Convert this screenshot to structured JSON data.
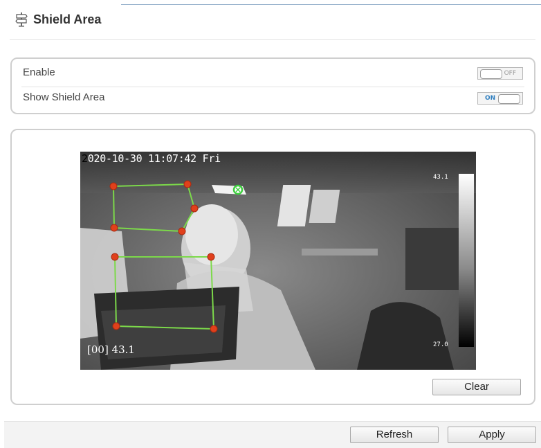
{
  "header": {
    "title": "Shield Area",
    "icon": "signpost-icon"
  },
  "settings": {
    "enable": {
      "label": "Enable",
      "state": "OFF",
      "checked": false
    },
    "show_shield_area": {
      "label": "Show Shield Area",
      "state": "ON",
      "checked": true
    }
  },
  "video": {
    "timestamp_first": "2",
    "timestamp_rest": "020-10-30 11:07:42 Fri",
    "temp_readout": "[00] 43.1",
    "scale_max": "43.1",
    "scale_min": "27.0",
    "shield_line_color": "#7cd94a",
    "vertex_color": "#e0401c"
  },
  "buttons": {
    "clear": "Clear",
    "refresh": "Refresh",
    "apply": "Apply"
  }
}
